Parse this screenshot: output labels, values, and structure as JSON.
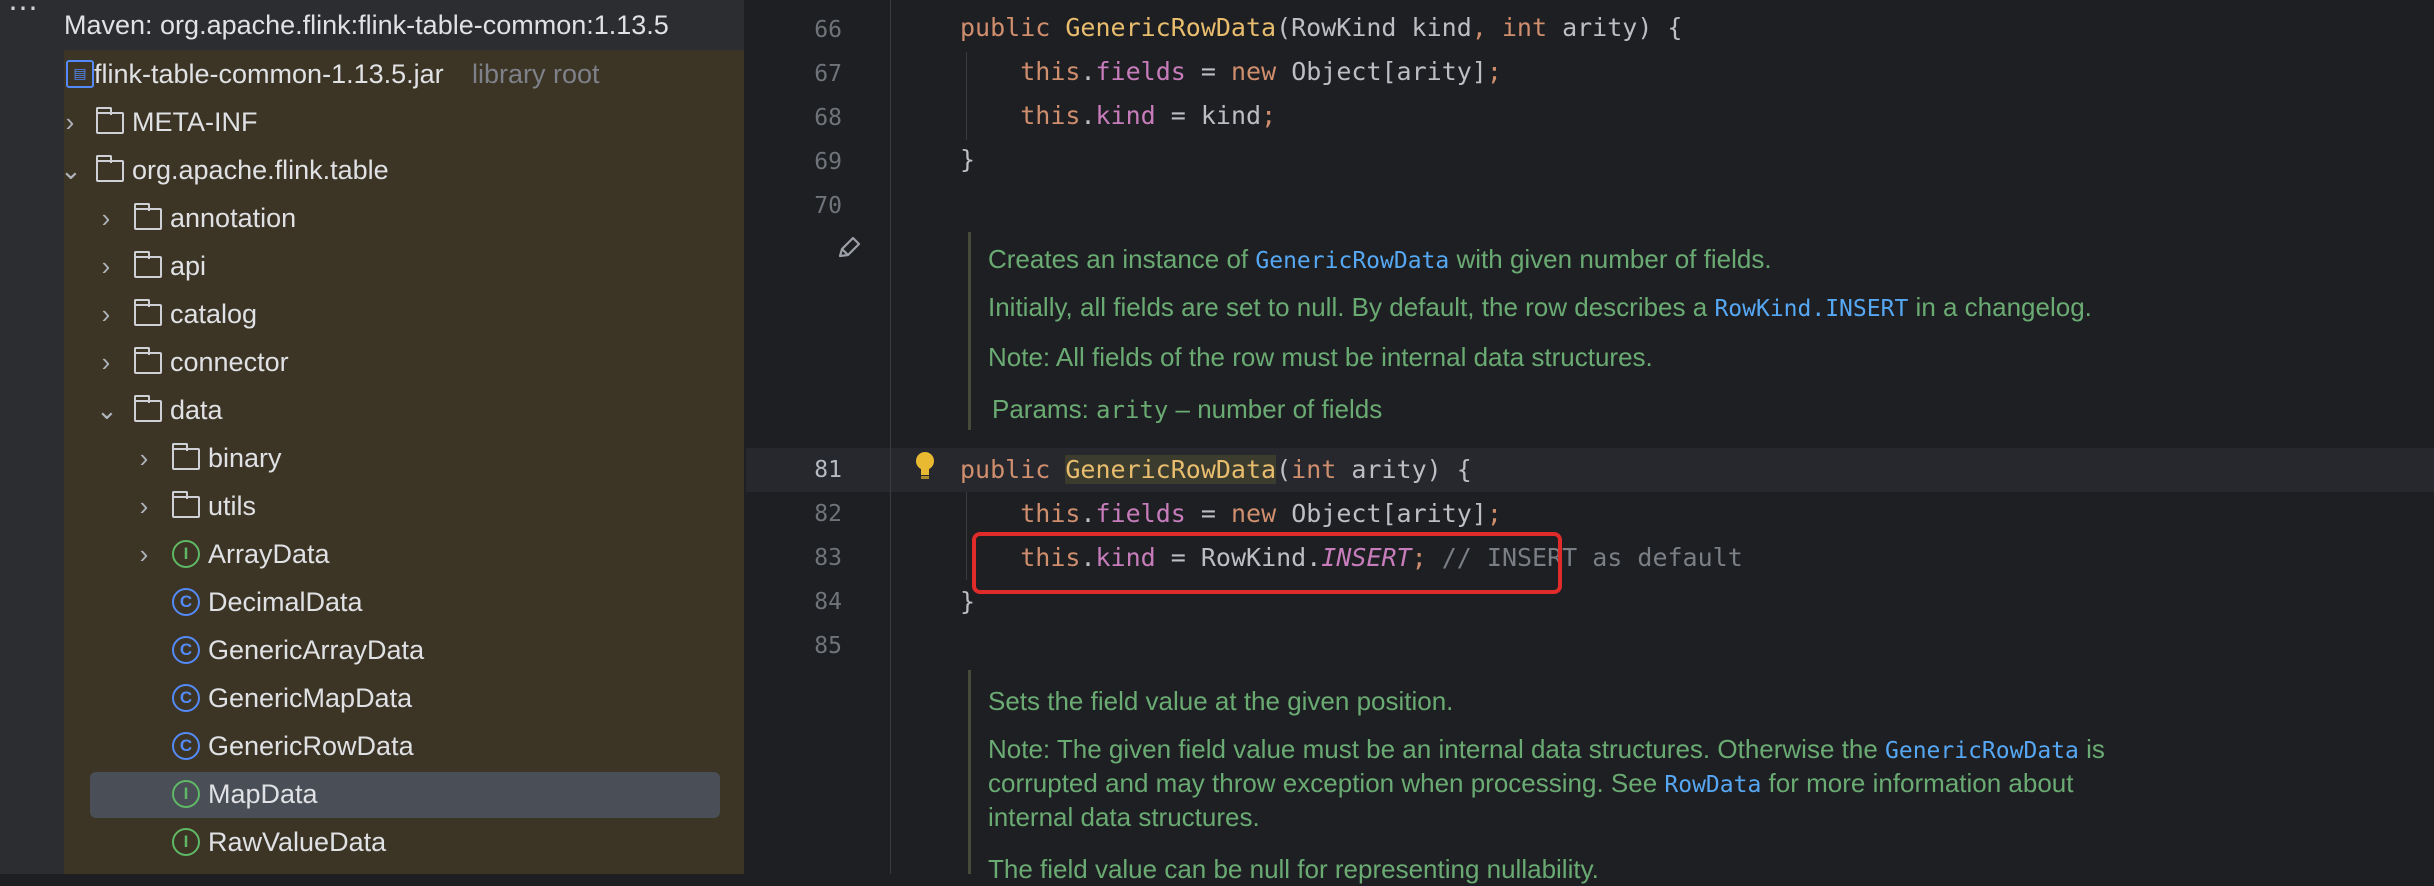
{
  "project": {
    "header": "Maven: org.apache.flink:flink-table-common:1.13.5",
    "tree": [
      {
        "label": "flink-table-common-1.13.5.jar",
        "suffix": "library root"
      },
      {
        "label": "META-INF"
      },
      {
        "label": "org.apache.flink.table"
      },
      {
        "label": "annotation"
      },
      {
        "label": "api"
      },
      {
        "label": "catalog"
      },
      {
        "label": "connector"
      },
      {
        "label": "data"
      },
      {
        "label": "binary"
      },
      {
        "label": "utils"
      },
      {
        "label": "ArrayData"
      },
      {
        "label": "DecimalData"
      },
      {
        "label": "GenericArrayData"
      },
      {
        "label": "GenericMapData"
      },
      {
        "label": "GenericRowData"
      },
      {
        "label": "MapData"
      },
      {
        "label": "RawValueData"
      }
    ],
    "selected": "GenericRowData"
  },
  "editor": {
    "line_numbers": [
      "66",
      "67",
      "68",
      "69",
      "70",
      "81",
      "82",
      "83",
      "84",
      "85"
    ],
    "docs": {
      "d1": {
        "prefix": "Creates an instance of ",
        "ref": "GenericRowData",
        "suffix": " with given number of fields."
      },
      "d2": {
        "prefix": "Initially, all fields are set to null. By default, the row describes a ",
        "ref": "RowKind.INSERT",
        "suffix": " in a changelog."
      },
      "d3": "Note: All fields of the row must be internal data structures.",
      "d4": {
        "label": "Params:",
        "param": "arity",
        "desc": " – number of fields"
      },
      "d5": "Sets the field value at the given position.",
      "d6": {
        "prefix": "Note: The given field value must be an internal data structures. Otherwise the ",
        "ref": "GenericRowData",
        "suffix": " is"
      },
      "d7": {
        "prefix": "corrupted and may throw exception when processing. See ",
        "ref": "RowData",
        "suffix": " for more information about"
      },
      "d8": "internal data structures.",
      "d9": "The field value can be null for representing nullability."
    },
    "comment": "// INSERT as default"
  },
  "colors": {
    "keyword": "#cf8e6d",
    "field": "#c77dbb",
    "doc_text": "#6aab73",
    "doc_ref": "#56a8f5",
    "highlight_box": "#e02b2b"
  }
}
